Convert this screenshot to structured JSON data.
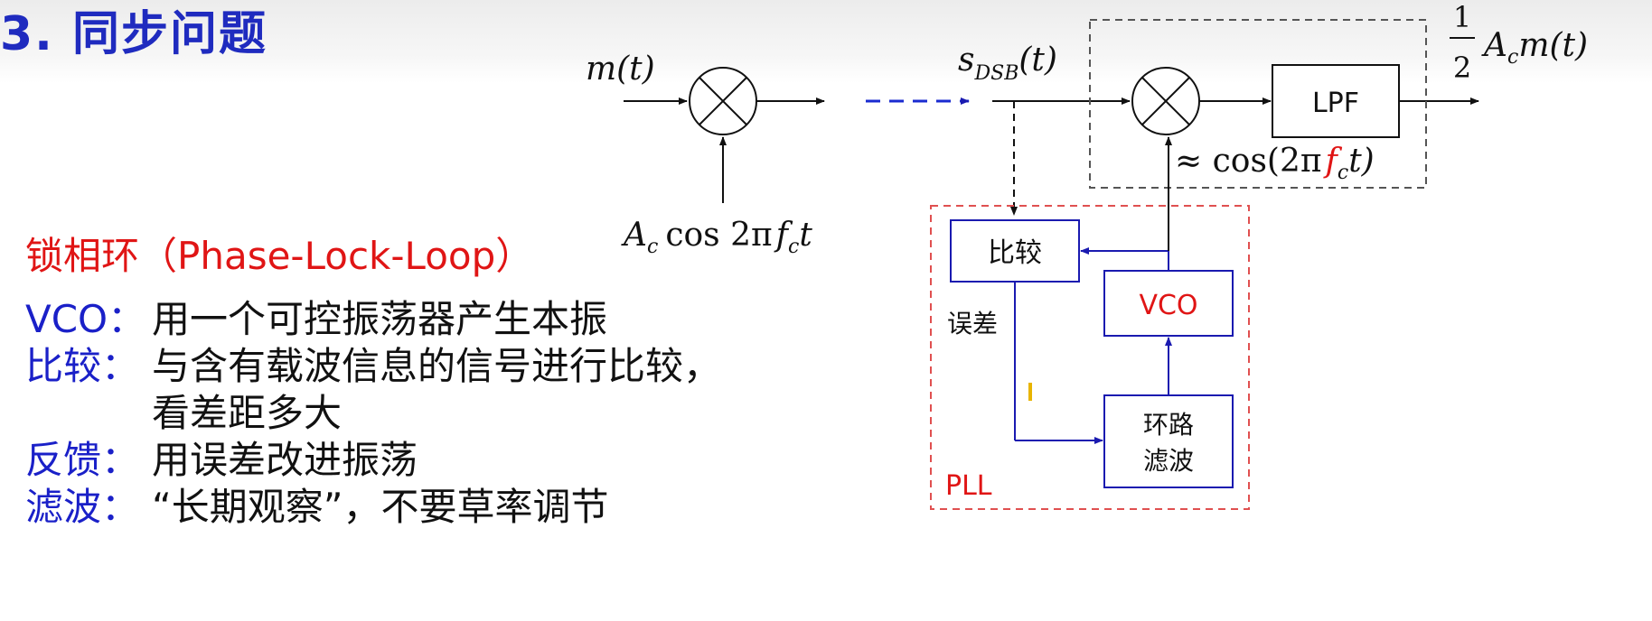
{
  "title": "3. 同步问题",
  "pll_heading": {
    "cn": "锁相环（",
    "p": "P",
    "hase": "hase-",
    "l1": "L",
    "ock": "ock-",
    "l2": "L",
    "oop": "oop）"
  },
  "items": [
    {
      "label": "VCO：",
      "desc": "用一个可控振荡器产生本振"
    },
    {
      "label": "比较：",
      "desc": "与含有载波信息的信号进行比较，"
    },
    {
      "label": "",
      "desc": "看差距多大"
    },
    {
      "label": "反馈：",
      "desc": "用误差改进振荡"
    },
    {
      "label": "滤波：",
      "desc": "“长期观察”，不要草率调节"
    }
  ],
  "diagram": {
    "input_signal": "m(t)",
    "carrier": {
      "amp": "A",
      "sub": "c",
      "cos": "cos 2π",
      "f": "f",
      "fsub": "c",
      "t": "t"
    },
    "dsb_signal": {
      "s": "s",
      "sub": "DSB",
      "arg": "(t)"
    },
    "lpf_label": "LPF",
    "output": {
      "num": "1",
      "den": "2",
      "amp": "A",
      "sub": "c",
      "rest": "m(t)"
    },
    "local_osc": {
      "approx": "≈ cos(2π",
      "f": "f",
      "fsub": "c",
      "t": "t)"
    },
    "compare_box": "比较",
    "vco_box": "VCO",
    "error_label": "误差",
    "loop_filter": {
      "line1": "环路",
      "line2": "滤波"
    },
    "pll_label": "PLL"
  },
  "colors": {
    "title": "#1f2bbf",
    "label": "#1a20c8",
    "heading": "#e01515",
    "pll_border": "#e05050",
    "loop_blue": "#1a1ab0"
  }
}
